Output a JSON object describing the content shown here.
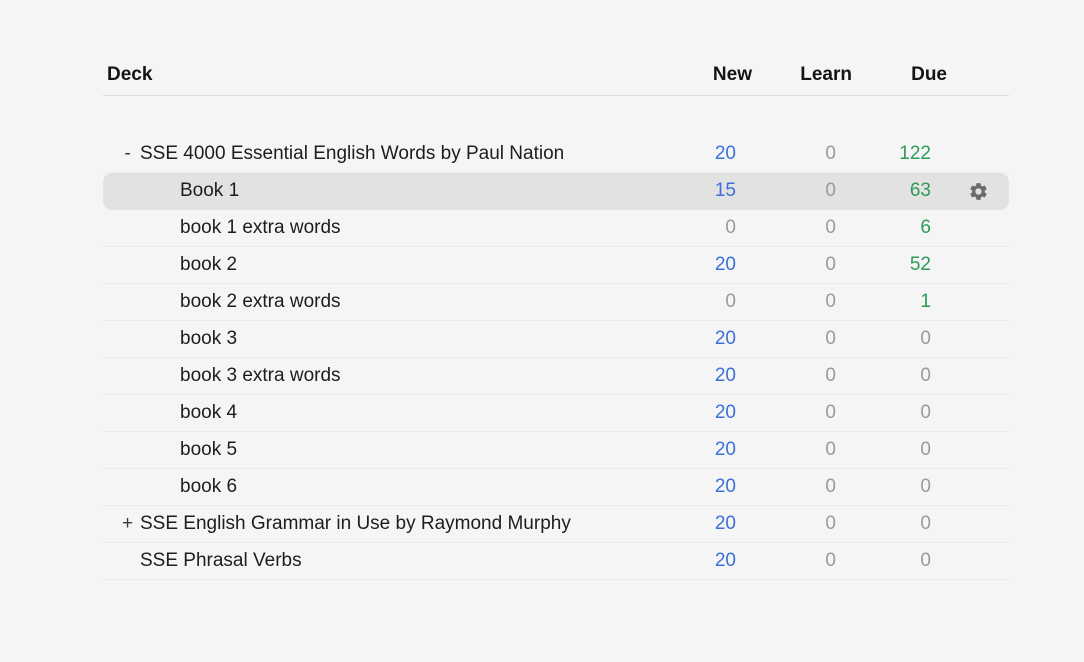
{
  "page": {
    "background": "#f5f5f5"
  },
  "table": {
    "headers": [
      {
        "key": "deck",
        "label": "Deck"
      },
      {
        "key": "new",
        "label": "New"
      },
      {
        "key": "learn",
        "label": "Learn"
      },
      {
        "key": "due",
        "label": "Due"
      }
    ],
    "colors": {
      "page_bg": "#f5f5f5",
      "new": "#3b6fd9",
      "learn": "#c0392b",
      "due": "#2e9b57",
      "zero": "#9a9a9a",
      "deck_text": "#1d1d1d",
      "selected_bg": "#e2e2e2",
      "gear": "#6b6b6b"
    },
    "rows": [
      {
        "name": "SSE 4000 Essential English Words by Paul Nation",
        "level": 0,
        "collapse": "-",
        "new": "20",
        "learn": "0",
        "due": "122",
        "selected": false,
        "gear": false
      },
      {
        "name": "Book 1",
        "level": 1,
        "collapse": "",
        "new": "15",
        "learn": "0",
        "due": "63",
        "selected": true,
        "gear": true
      },
      {
        "name": "book 1 extra words",
        "level": 1,
        "collapse": "",
        "new": "0",
        "learn": "0",
        "due": "6",
        "selected": false,
        "gear": false
      },
      {
        "name": "book 2",
        "level": 1,
        "collapse": "",
        "new": "20",
        "learn": "0",
        "due": "52",
        "selected": false,
        "gear": false
      },
      {
        "name": "book 2 extra words",
        "level": 1,
        "collapse": "",
        "new": "0",
        "learn": "0",
        "due": "1",
        "selected": false,
        "gear": false
      },
      {
        "name": "book 3",
        "level": 1,
        "collapse": "",
        "new": "20",
        "learn": "0",
        "due": "0",
        "selected": false,
        "gear": false
      },
      {
        "name": "book 3 extra words",
        "level": 1,
        "collapse": "",
        "new": "20",
        "learn": "0",
        "due": "0",
        "selected": false,
        "gear": false
      },
      {
        "name": "book 4",
        "level": 1,
        "collapse": "",
        "new": "20",
        "learn": "0",
        "due": "0",
        "selected": false,
        "gear": false
      },
      {
        "name": "book 5",
        "level": 1,
        "collapse": "",
        "new": "20",
        "learn": "0",
        "due": "0",
        "selected": false,
        "gear": false
      },
      {
        "name": "book 6",
        "level": 1,
        "collapse": "",
        "new": "20",
        "learn": "0",
        "due": "0",
        "selected": false,
        "gear": false
      },
      {
        "name": "SSE English Grammar in Use by Raymond Murphy",
        "level": 0,
        "collapse": "+",
        "new": "20",
        "learn": "0",
        "due": "0",
        "selected": false,
        "gear": false
      },
      {
        "name": "SSE Phrasal Verbs",
        "level": 0,
        "collapse": "",
        "new": "20",
        "learn": "0",
        "due": "0",
        "selected": false,
        "gear": false
      }
    ]
  }
}
